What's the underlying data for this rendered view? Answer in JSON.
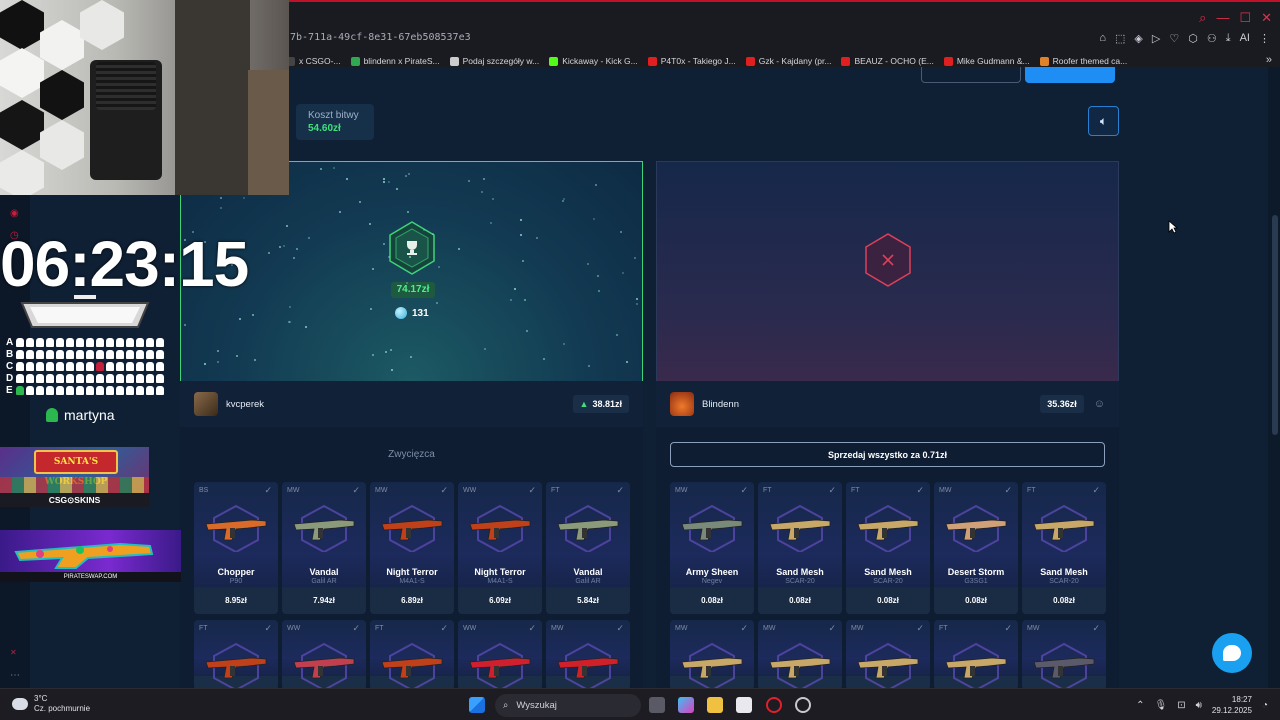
{
  "browser": {
    "url": "7b-711a-49cf-8e31-67eb508537e3",
    "bookmarks": [
      {
        "label": "x CSGO-...",
        "color": "#444"
      },
      {
        "label": "blindenn x PirateS...",
        "color": "#2fa84f"
      },
      {
        "label": "Podaj szczegóły w...",
        "color": "#cccccc"
      },
      {
        "label": "Kickaway - Kick G...",
        "color": "#53fc18"
      },
      {
        "label": "P4T0x - Takiego J...",
        "color": "#e02020"
      },
      {
        "label": "Gzk - Kajdany (pr...",
        "color": "#e02020"
      },
      {
        "label": "BEAUZ - OCHO (E...",
        "color": "#e02020"
      },
      {
        "label": "Mike Gudmann &...",
        "color": "#e02020"
      },
      {
        "label": "Roofer themed ca...",
        "color": "#e0822a"
      }
    ],
    "more_bookmarks": "»",
    "ai_label": "AI"
  },
  "battle": {
    "cost_label": "Koszt bitwy",
    "cost_value": "54.60zł",
    "left": {
      "win_amount": "74.17zł",
      "coins": "131",
      "player_name": "kvcperek",
      "player_value": "38.81zł",
      "winner_label": "Zwycięzca"
    },
    "right": {
      "player_name": "Blindenn",
      "player_value": "35.36zł",
      "sell_all_label": "Sprzedaj wszystko za 0.71zł"
    }
  },
  "left_items": [
    {
      "wear": "BS",
      "name": "Chopper",
      "sub": "P90",
      "price": "8.95zł",
      "color": "#d86a2a"
    },
    {
      "wear": "MW",
      "name": "Vandal",
      "sub": "Galil AR",
      "price": "7.94zł",
      "color": "#8a9a7a"
    },
    {
      "wear": "MW",
      "name": "Night Terror",
      "sub": "M4A1-S",
      "price": "6.89zł",
      "color": "#c0401a"
    },
    {
      "wear": "WW",
      "name": "Night Terror",
      "sub": "M4A1-S",
      "price": "6.09zł",
      "color": "#c0401a"
    },
    {
      "wear": "FT",
      "name": "Vandal",
      "sub": "Galil AR",
      "price": "5.84zł",
      "color": "#8a9a7a"
    }
  ],
  "right_items": [
    {
      "wear": "MW",
      "name": "Army Sheen",
      "sub": "Negev",
      "price": "0.08zł",
      "color": "#7a8a7a"
    },
    {
      "wear": "FT",
      "name": "Sand Mesh",
      "sub": "SCAR-20",
      "price": "0.08zł",
      "color": "#c8a868"
    },
    {
      "wear": "FT",
      "name": "Sand Mesh",
      "sub": "SCAR-20",
      "price": "0.08zł",
      "color": "#c8a868"
    },
    {
      "wear": "MW",
      "name": "Desert Storm",
      "sub": "G3SG1",
      "price": "0.08zł",
      "color": "#d0a078"
    },
    {
      "wear": "FT",
      "name": "Sand Mesh",
      "sub": "SCAR-20",
      "price": "0.08zł",
      "color": "#c8a868"
    }
  ],
  "left_items_row2": [
    {
      "wear": "FT",
      "color": "#c0401a"
    },
    {
      "wear": "WW",
      "color": "#c04050"
    },
    {
      "wear": "FT",
      "color": "#c0401a"
    },
    {
      "wear": "WW",
      "color": "#d02030"
    },
    {
      "wear": "MW",
      "color": "#d0202a"
    }
  ],
  "right_items_row2": [
    {
      "wear": "MW",
      "color": "#c8a868"
    },
    {
      "wear": "MW",
      "color": "#c8a868"
    },
    {
      "wear": "MW",
      "color": "#c8a868"
    },
    {
      "wear": "FT",
      "color": "#c8a868"
    },
    {
      "wear": "MW",
      "color": "#5a5a6a"
    }
  ],
  "overlay": {
    "timer": "06:23:15",
    "seat_rows": [
      "A",
      "B",
      "C",
      "D",
      "E"
    ],
    "viewer_name": "martyna",
    "sponsor1_title": "SANTA'S WORKSHOP",
    "sponsor1_brand": "CSG⊙SKINS",
    "sponsor2_brand": "PIRATESWAP.COM"
  },
  "taskbar": {
    "temperature": "3°C",
    "weather": "Cz. pochmurnie",
    "search_label": "Wyszukaj",
    "time": "18:27",
    "date": "29.12.2025"
  }
}
